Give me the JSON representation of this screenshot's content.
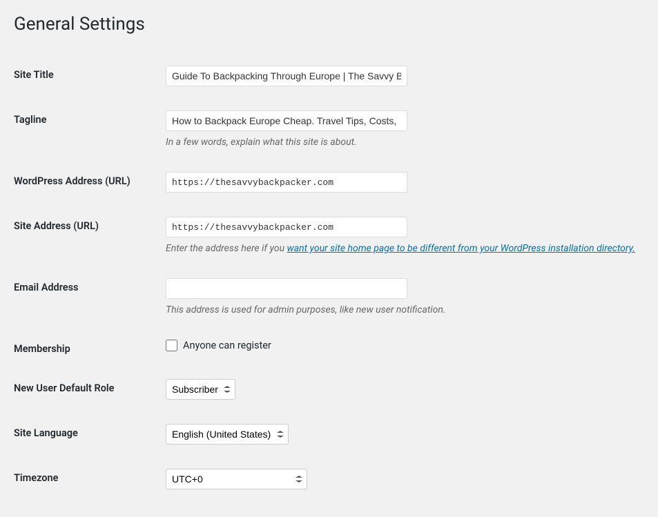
{
  "page_title": "General Settings",
  "fields": {
    "site_title": {
      "label": "Site Title",
      "value": "Guide To Backpacking Through Europe | The Savvy Backpacker"
    },
    "tagline": {
      "label": "Tagline",
      "value": "How to Backpack Europe Cheap. Travel Tips, Costs,",
      "description": "In a few words, explain what this site is about."
    },
    "wp_url": {
      "label": "WordPress Address (URL)",
      "value": "https://thesavvybackpacker.com"
    },
    "site_url": {
      "label": "Site Address (URL)",
      "value": "https://thesavvybackpacker.com",
      "description_prefix": "Enter the address here if you ",
      "description_link": "want your site home page to be different from your WordPress installation directory."
    },
    "email": {
      "label": "Email Address",
      "value": "",
      "description": "This address is used for admin purposes, like new user notification."
    },
    "membership": {
      "label": "Membership",
      "checkbox_label": "Anyone can register"
    },
    "default_role": {
      "label": "New User Default Role",
      "value": "Subscriber"
    },
    "site_language": {
      "label": "Site Language",
      "value": "English (United States)"
    },
    "timezone": {
      "label": "Timezone",
      "value": "UTC+0"
    }
  }
}
